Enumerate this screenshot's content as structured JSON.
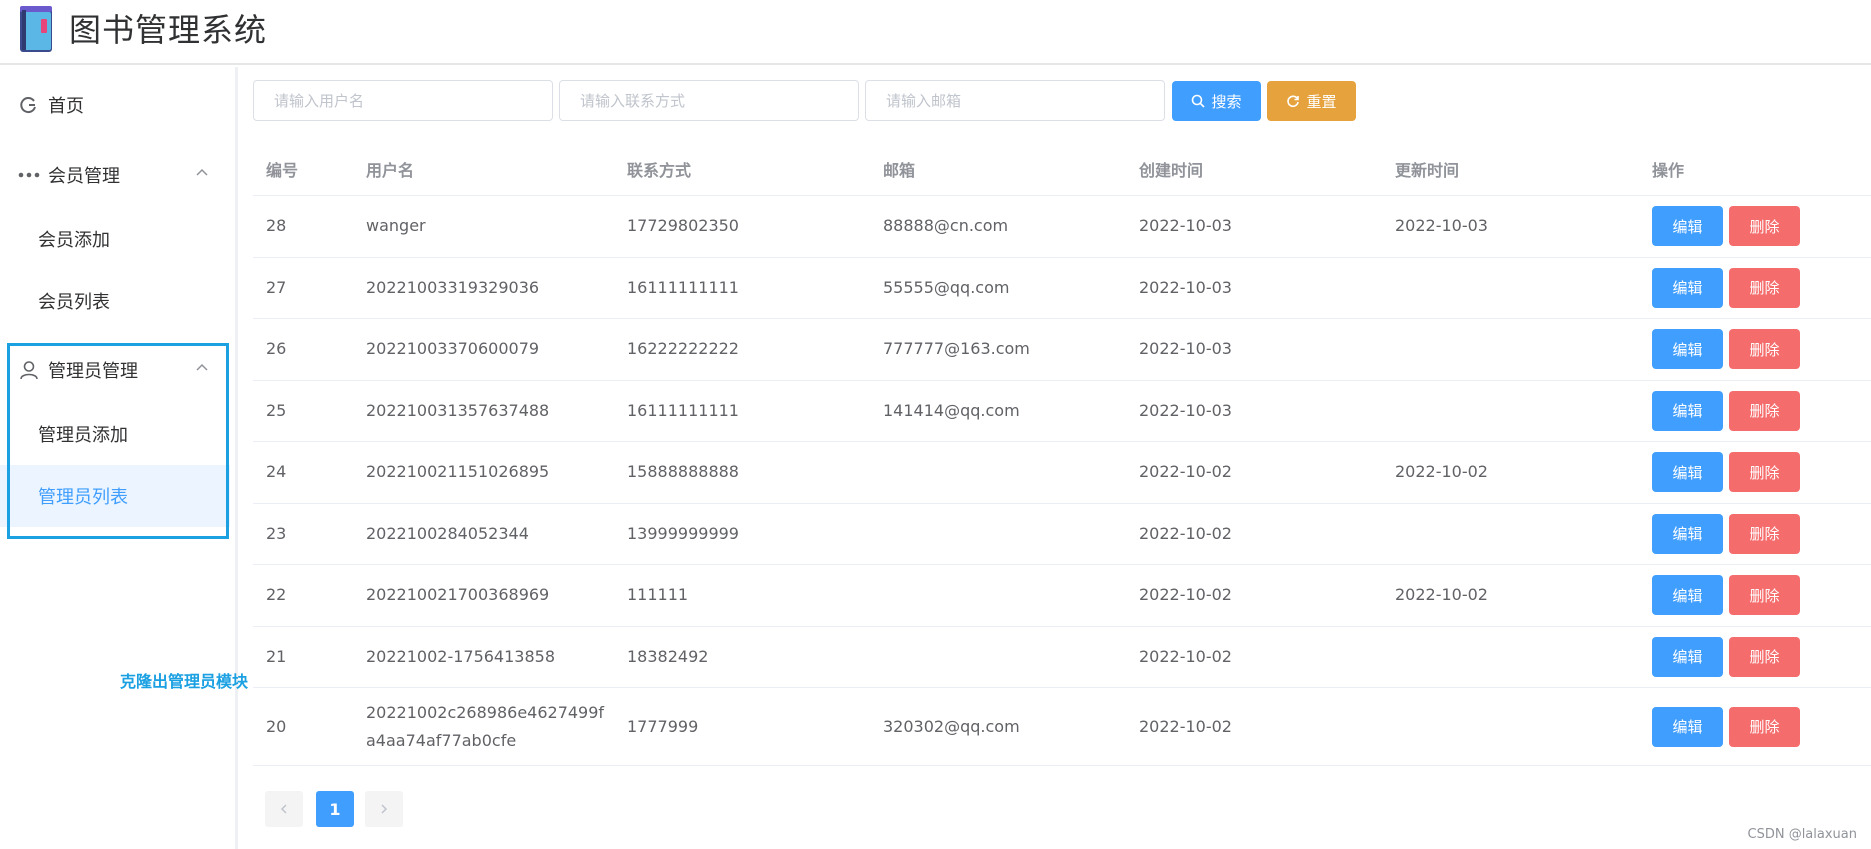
{
  "header": {
    "title": "图书管理系统"
  },
  "sidebar": {
    "home_label": "首页",
    "member_group_label": "会员管理",
    "member_add_label": "会员添加",
    "member_list_label": "会员列表",
    "admin_group_label": "管理员管理",
    "admin_add_label": "管理员添加",
    "admin_list_label": "管理员列表"
  },
  "annotation": "克隆出管理员模块",
  "search": {
    "username_placeholder": "请输入用户名",
    "phone_placeholder": "请输入联系方式",
    "email_placeholder": "请输入邮箱",
    "search_label": "搜索",
    "reset_label": "重置"
  },
  "table": {
    "columns": [
      "编号",
      "用户名",
      "联系方式",
      "邮箱",
      "创建时间",
      "更新时间",
      "操作"
    ],
    "edit_label": "编辑",
    "delete_label": "删除",
    "rows": [
      {
        "id": "28",
        "username": "wanger",
        "phone": "17729802350",
        "email": "88888@cn.com",
        "created": "2022-10-03",
        "updated": "2022-10-03"
      },
      {
        "id": "27",
        "username": "20221003319329036",
        "phone": "16111111111",
        "email": "55555@qq.com",
        "created": "2022-10-03",
        "updated": ""
      },
      {
        "id": "26",
        "username": "20221003370600079",
        "phone": "16222222222",
        "email": "777777@163.com",
        "created": "2022-10-03",
        "updated": ""
      },
      {
        "id": "25",
        "username": "202210031357637488",
        "phone": "16111111111",
        "email": "141414@qq.com",
        "created": "2022-10-03",
        "updated": ""
      },
      {
        "id": "24",
        "username": "202210021151026895",
        "phone": "15888888888",
        "email": "",
        "created": "2022-10-02",
        "updated": "2022-10-02"
      },
      {
        "id": "23",
        "username": "2022100284052344",
        "phone": "13999999999",
        "email": "",
        "created": "2022-10-02",
        "updated": ""
      },
      {
        "id": "22",
        "username": "202210021700368969",
        "phone": "111111",
        "email": "",
        "created": "2022-10-02",
        "updated": "2022-10-02"
      },
      {
        "id": "21",
        "username": "20221002-1756413858",
        "phone": "18382492",
        "email": "",
        "created": "2022-10-02",
        "updated": ""
      },
      {
        "id": "20",
        "username": "20221002c268986e4627499fa4aa74af77ab0cfe",
        "phone": "1777999",
        "email": "320302@qq.com",
        "created": "2022-10-02",
        "updated": ""
      }
    ]
  },
  "pagination": {
    "current_page": "1",
    "prev_icon": "chevron-left-icon",
    "next_icon": "chevron-right-icon"
  },
  "watermark": "CSDN @lalaxuan",
  "colors": {
    "primary": "#409eff",
    "warning": "#e6a23c",
    "danger": "#f56c6c",
    "annotation": "#1ba0e2"
  }
}
